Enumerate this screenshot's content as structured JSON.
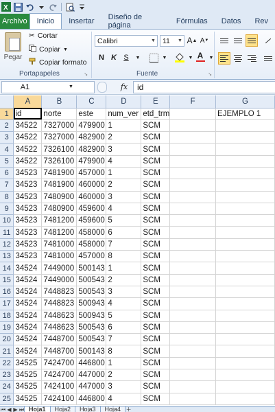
{
  "ribbon_tabs": [
    "Archivo",
    "Inicio",
    "Insertar",
    "Diseño de página",
    "Fórmulas",
    "Datos",
    "Rev"
  ],
  "active_tab": "Inicio",
  "clipboard": {
    "paste": "Pegar",
    "cut": "Cortar",
    "copy": "Copiar",
    "format_painter": "Copiar formato",
    "group": "Portapapeles"
  },
  "font": {
    "name": "Calibri",
    "size": "11",
    "group": "Fuente",
    "bold": "N",
    "italic": "K",
    "underline": "S",
    "grow": "A",
    "shrink": "A",
    "font_color_label": "A"
  },
  "formula_bar": {
    "name_box": "A1",
    "fx": "fx",
    "content": "id"
  },
  "columns": [
    "A",
    "B",
    "C",
    "D",
    "E",
    "F",
    "G"
  ],
  "rows": [
    {
      "n": "1",
      "cells": [
        "id",
        "norte",
        "este",
        "num_ver",
        "etd_trm",
        "",
        "EJEMPLO 1"
      ]
    },
    {
      "n": "2",
      "cells": [
        "34522",
        "7327000",
        "479900",
        "1",
        "SCM",
        "",
        ""
      ]
    },
    {
      "n": "3",
      "cells": [
        "34522",
        "7327000",
        "482900",
        "2",
        "SCM",
        "",
        ""
      ]
    },
    {
      "n": "4",
      "cells": [
        "34522",
        "7326100",
        "482900",
        "3",
        "SCM",
        "",
        ""
      ]
    },
    {
      "n": "5",
      "cells": [
        "34522",
        "7326100",
        "479900",
        "4",
        "SCM",
        "",
        ""
      ]
    },
    {
      "n": "6",
      "cells": [
        "34523",
        "7481900",
        "457000",
        "1",
        "SCM",
        "",
        ""
      ]
    },
    {
      "n": "7",
      "cells": [
        "34523",
        "7481900",
        "460000",
        "2",
        "SCM",
        "",
        ""
      ]
    },
    {
      "n": "8",
      "cells": [
        "34523",
        "7480900",
        "460000",
        "3",
        "SCM",
        "",
        ""
      ]
    },
    {
      "n": "9",
      "cells": [
        "34523",
        "7480900",
        "459600",
        "4",
        "SCM",
        "",
        ""
      ]
    },
    {
      "n": "10",
      "cells": [
        "34523",
        "7481200",
        "459600",
        "5",
        "SCM",
        "",
        ""
      ]
    },
    {
      "n": "11",
      "cells": [
        "34523",
        "7481200",
        "458000",
        "6",
        "SCM",
        "",
        ""
      ]
    },
    {
      "n": "12",
      "cells": [
        "34523",
        "7481000",
        "458000",
        "7",
        "SCM",
        "",
        ""
      ]
    },
    {
      "n": "13",
      "cells": [
        "34523",
        "7481000",
        "457000",
        "8",
        "SCM",
        "",
        ""
      ]
    },
    {
      "n": "14",
      "cells": [
        "34524",
        "7449000",
        "500143",
        "1",
        "SCM",
        "",
        ""
      ]
    },
    {
      "n": "15",
      "cells": [
        "34524",
        "7449000",
        "500543",
        "2",
        "SCM",
        "",
        ""
      ]
    },
    {
      "n": "16",
      "cells": [
        "34524",
        "7448823",
        "500543",
        "3",
        "SCM",
        "",
        ""
      ]
    },
    {
      "n": "17",
      "cells": [
        "34524",
        "7448823",
        "500943",
        "4",
        "SCM",
        "",
        ""
      ]
    },
    {
      "n": "18",
      "cells": [
        "34524",
        "7448623",
        "500943",
        "5",
        "SCM",
        "",
        ""
      ]
    },
    {
      "n": "19",
      "cells": [
        "34524",
        "7448623",
        "500543",
        "6",
        "SCM",
        "",
        ""
      ]
    },
    {
      "n": "20",
      "cells": [
        "34524",
        "7448700",
        "500543",
        "7",
        "SCM",
        "",
        ""
      ]
    },
    {
      "n": "21",
      "cells": [
        "34524",
        "7448700",
        "500143",
        "8",
        "SCM",
        "",
        ""
      ]
    },
    {
      "n": "22",
      "cells": [
        "34525",
        "7424700",
        "446800",
        "1",
        "SCM",
        "",
        ""
      ]
    },
    {
      "n": "23",
      "cells": [
        "34525",
        "7424700",
        "447000",
        "2",
        "SCM",
        "",
        ""
      ]
    },
    {
      "n": "24",
      "cells": [
        "34525",
        "7424100",
        "447000",
        "3",
        "SCM",
        "",
        ""
      ]
    },
    {
      "n": "25",
      "cells": [
        "34525",
        "7424100",
        "446800",
        "4",
        "SCM",
        "",
        ""
      ]
    }
  ],
  "sheet_tabs": [
    "Hoja1",
    "Hoja2",
    "Hoja3",
    "Hoja4"
  ],
  "active_sheet": "Hoja1",
  "colors": {
    "file_tab": "#2a8a3e",
    "header_bg": "#e4ecf7",
    "selected_header": "#f9d99a",
    "ribbon_bg": "#dfe9f5"
  }
}
